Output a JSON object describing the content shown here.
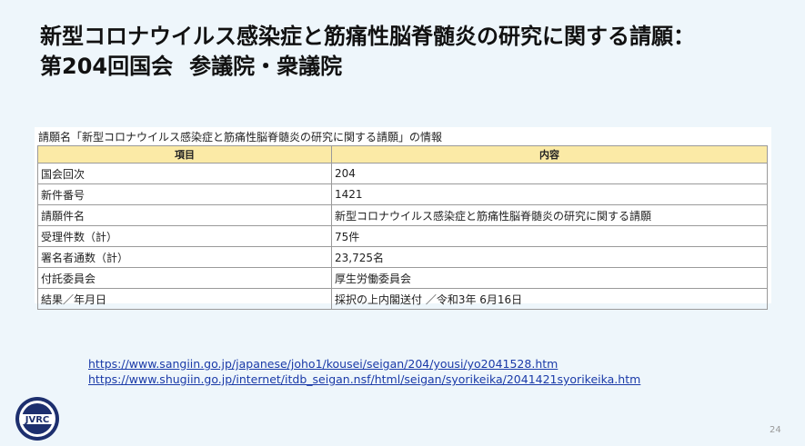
{
  "title": {
    "line1": "新型コロナウイルス感染症と筋痛性脳脊髄炎の研究に関する請願：",
    "line2_part1": "第204回国会",
    "line2_part2": "参議院・衆議院"
  },
  "table": {
    "caption": "請願名「新型コロナウイルス感染症と筋痛性脳脊髄炎の研究に関する請願」の情報",
    "headers": [
      "項目",
      "内容"
    ],
    "rows": [
      {
        "item": "国会回次",
        "value": "204"
      },
      {
        "item": "新件番号",
        "value": "1421"
      },
      {
        "item": "請願件名",
        "value": "新型コロナウイルス感染症と筋痛性脳脊髄炎の研究に関する請願"
      },
      {
        "item": "受理件数（計）",
        "value": "75件"
      },
      {
        "item": "署名者通数（計）",
        "value": "23,725名"
      },
      {
        "item": "付託委員会",
        "value": "厚生労働委員会"
      },
      {
        "item": "結果／年月日",
        "value": "採択の上内閣送付 ／令和3年 6月16日"
      }
    ],
    "header_color": "#fbeaa6"
  },
  "links": [
    "https://www.sangiin.go.jp/japanese/joho1/kousei/seigan/204/yousi/yo2041528.htm",
    "https://www.shugiin.go.jp/internet/itdb_seigan.nsf/html/seigan/syorikeika/2041421syorikeika.htm"
  ],
  "logo": {
    "text": "JVRC",
    "icon": "organization-logo-icon"
  },
  "page_number": "24"
}
